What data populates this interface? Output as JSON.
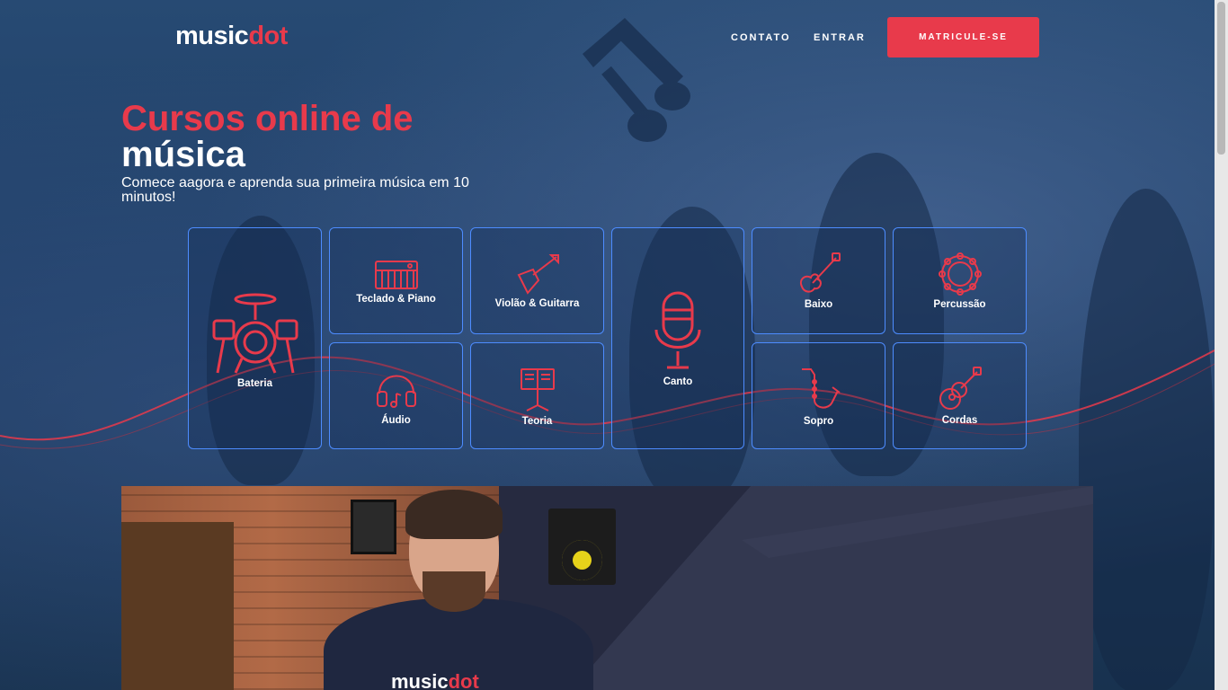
{
  "header": {
    "logo": {
      "text_main": "music",
      "text_accent": "dot"
    },
    "nav": [
      {
        "label": "CONTATO"
      },
      {
        "label": "ENTRAR"
      }
    ],
    "cta_label": "MATRICULE-SE"
  },
  "hero": {
    "title_line1": "Cursos online de",
    "title_line2": "música",
    "subtitle": "Comece aagora e aprenda sua primeira música em 10 minutos!"
  },
  "courses": [
    {
      "label": "Bateria",
      "icon": "drums-icon"
    },
    {
      "label": "Teclado & Piano",
      "icon": "keyboard-icon"
    },
    {
      "label": "Violão & Guitarra",
      "icon": "guitar-icon"
    },
    {
      "label": "Canto",
      "icon": "microphone-icon"
    },
    {
      "label": "Baixo",
      "icon": "bass-icon"
    },
    {
      "label": "Percussão",
      "icon": "tambourine-icon"
    },
    {
      "label": "Áudio",
      "icon": "headphones-icon"
    },
    {
      "label": "Teoria",
      "icon": "music-stand-icon"
    },
    {
      "label": "Sopro",
      "icon": "saxophone-icon"
    },
    {
      "label": "Cordas",
      "icon": "ukulele-icon"
    }
  ],
  "video": {
    "shirt_logo_main": "music",
    "shirt_logo_accent": "dot"
  },
  "colors": {
    "accent": "#e83a4b",
    "tile_border": "#4d8cff",
    "background": "#1f3e66"
  }
}
